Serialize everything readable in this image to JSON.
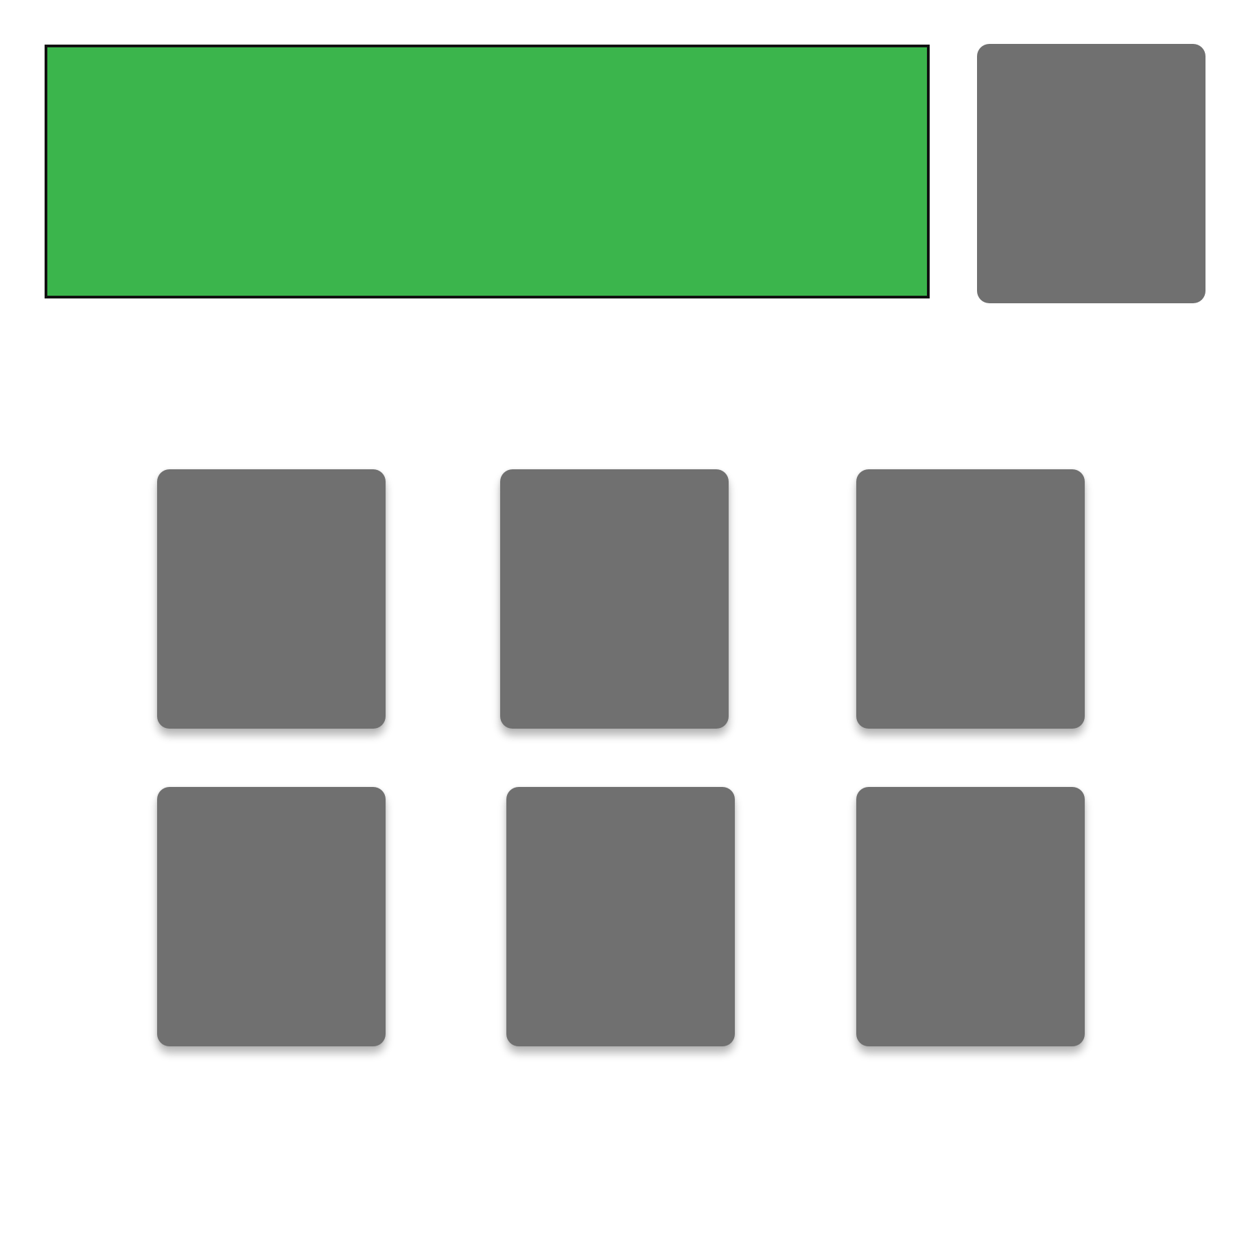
{
  "display": {
    "background_color": "#3bb54c",
    "border_color": "#111111",
    "text": ""
  },
  "keys": {
    "color": "#707070",
    "top_key_label": "",
    "grid": [
      {
        "label": ""
      },
      {
        "label": ""
      },
      {
        "label": ""
      },
      {
        "label": ""
      },
      {
        "label": ""
      },
      {
        "label": ""
      }
    ]
  }
}
